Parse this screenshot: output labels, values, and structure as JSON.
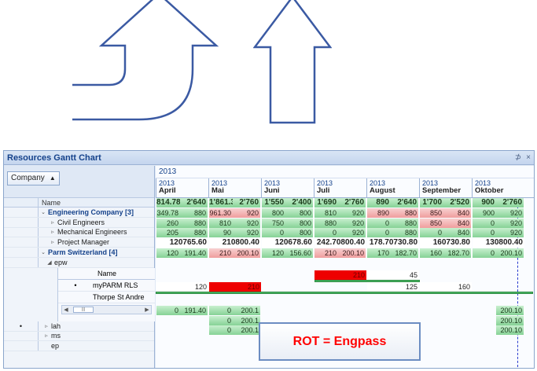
{
  "panel": {
    "title": "Resources Gantt Chart",
    "pin": "⊅",
    "close": "×"
  },
  "grouping": {
    "label": "Company",
    "sort": "▲"
  },
  "grid": {
    "name_header": "Name",
    "rows": [
      {
        "label": "Engineering Company [3]",
        "expander": "⌄",
        "bold": true
      },
      {
        "label": "Civil Engineers",
        "expander": "▹"
      },
      {
        "label": "Mechanical Engineers",
        "expander": "▹"
      },
      {
        "label": "Project Manager",
        "expander": "▹"
      },
      {
        "label": "Parm Switzerland [4]",
        "expander": "⌄",
        "bold": true
      },
      {
        "label": "epw",
        "expander": "◢"
      }
    ],
    "sub": {
      "header": "Name",
      "rows": [
        {
          "bullet": "•",
          "label": "myPARM RLS"
        },
        {
          "bullet": "",
          "label": "Thorpe St Andre"
        }
      ]
    },
    "bottom_rows": [
      {
        "bullet": "•",
        "label": "lah",
        "expander": "▹"
      },
      {
        "bullet": "",
        "label": "ms",
        "expander": "▹"
      },
      {
        "bullet": "",
        "label": "ep",
        "expander": ""
      }
    ]
  },
  "timeline": {
    "year": "2013",
    "months": [
      {
        "year": "2013",
        "name": "April"
      },
      {
        "year": "2013",
        "name": "Mai"
      },
      {
        "year": "2013",
        "name": "Juni"
      },
      {
        "year": "2013",
        "name": "Juli"
      },
      {
        "year": "2013",
        "name": "August"
      },
      {
        "year": "2013",
        "name": "September"
      },
      {
        "year": "2013",
        "name": "Oktober"
      }
    ],
    "rows": [
      [
        "814.78",
        "2'640",
        "1'861.30",
        "2'760",
        "1'550",
        "2'400",
        "1'690",
        "2'760",
        "890",
        "2'640",
        "1'700",
        "2'520",
        "900",
        "2'760"
      ],
      [
        "349.78",
        "880",
        "961.30",
        "920",
        "800",
        "800",
        "810",
        "920",
        "890",
        "880",
        "850",
        "840",
        "900",
        "920"
      ],
      [
        "260",
        "880",
        "810",
        "920",
        "750",
        "800",
        "880",
        "920",
        "0",
        "880",
        "850",
        "840",
        "0",
        "920"
      ],
      [
        "205",
        "880",
        "90",
        "920",
        "0",
        "800",
        "0",
        "920",
        "0",
        "880",
        "0",
        "840",
        "0",
        "920"
      ],
      [
        "120765.60",
        "210800.40",
        "120678.60",
        "242.70800.40",
        "178.70730.80",
        "160730.80",
        "130800.40"
      ],
      [
        "120",
        "191.40",
        "210",
        "200.10",
        "120",
        "156.60",
        "210",
        "200.10",
        "170",
        "182.70",
        "160",
        "182.70",
        "0",
        "200.10"
      ]
    ],
    "sub_row1": {
      "july": "210",
      "august": "45"
    },
    "sub_row2": {
      "april": "120",
      "mai": "210",
      "august": "125",
      "september": "160"
    },
    "bottom": {
      "lah": [
        "0",
        "191.40",
        "0",
        "200.1",
        "200.10"
      ],
      "ms": [
        "",
        "0",
        "200.1",
        "200.10"
      ],
      "ep": [
        "",
        "0",
        "200.1",
        "200.10"
      ]
    }
  },
  "callout": {
    "text": "ROT = Engpass"
  }
}
